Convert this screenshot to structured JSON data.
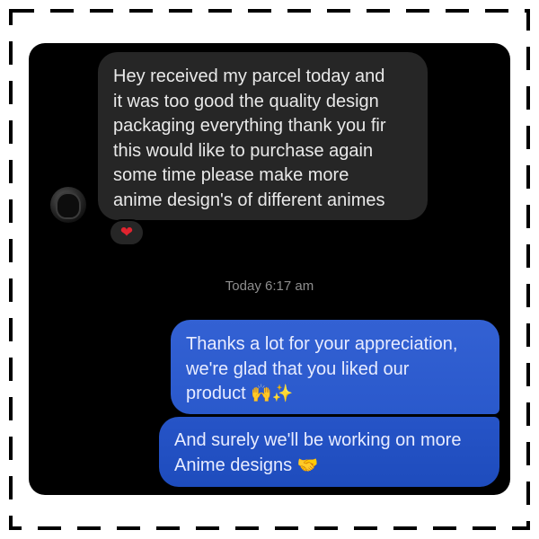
{
  "conversation": {
    "incoming_message": "Hey received my parcel today and\nit was too good the quality design\npackaging everything thank you fir\nthis would like to purchase again\nsome time please make more\nanime design's of different animes",
    "reaction": "❤",
    "timestamp": "Today 6:17 am",
    "outgoing_1_text": "Thanks a lot for your appreciation,\nwe're glad that you liked our\nproduct ",
    "outgoing_1_emoji": "🙌✨",
    "outgoing_2_text": "And surely we'll be working on more\nAnime designs ",
    "outgoing_2_emoji": "🤝"
  },
  "colors": {
    "background": "#000000",
    "incoming_bubble": "#262626",
    "outgoing_bubble": "#2a59cc",
    "reaction_heart": "#e0242f",
    "timestamp_text": "#8e8e8e"
  },
  "icons": {
    "avatar": "profile-avatar",
    "reaction": "heart-icon"
  }
}
